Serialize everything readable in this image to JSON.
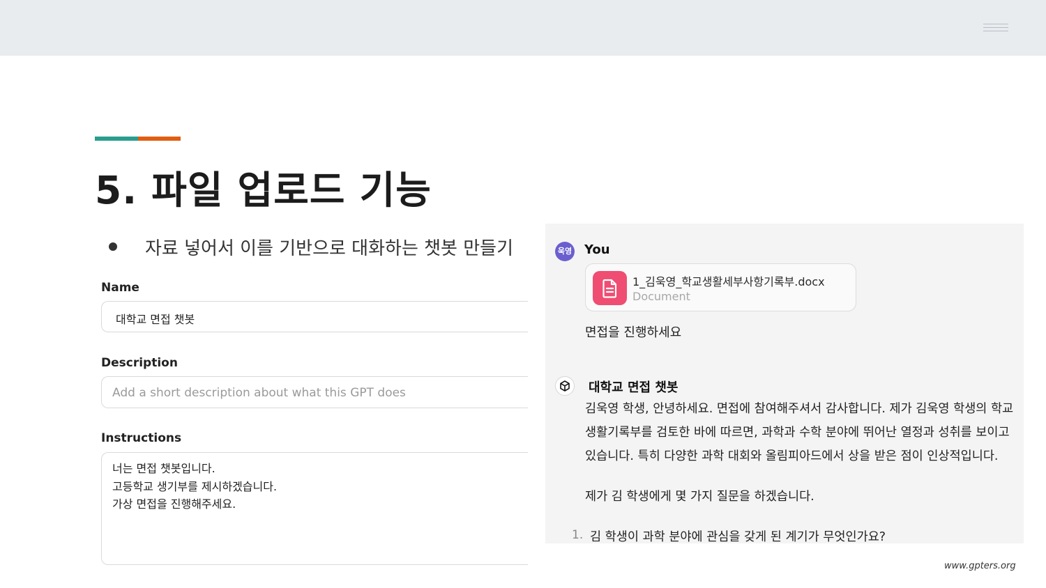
{
  "slide": {
    "title": "5. 파일 업로드 기능",
    "bullet": "자료 넣어서 이를 기반으로 대화하는 챗봇 만들기",
    "footer": "www.gpters.org",
    "accent_colors": [
      "#2a9d8f",
      "#e05d12"
    ]
  },
  "form": {
    "name_label": "Name",
    "name_value": "대학교 면접 챗봇",
    "description_label": "Description",
    "description_placeholder": "Add a short description about what this GPT does",
    "instructions_label": "Instructions",
    "instructions_lines": [
      "너는 면접 챗봇입니다.",
      "고등학교 생기부를 제시하겠습니다.",
      "가상 면접을 진행해주세요."
    ]
  },
  "chat": {
    "user": {
      "avatar_text": "욱영",
      "name": "You",
      "file_name": "1_김욱영_학교생활세부사항기록부.docx",
      "file_type": "Document",
      "file_icon": "document-icon",
      "message": "면접을 진행하세요"
    },
    "bot": {
      "avatar_icon": "gpt-cube-icon",
      "name": "대학교 면접 챗봇",
      "lines": [
        "김욱영 학생, 안녕하세요. 면접에 참여해주셔서 감사합니다. 제가 김욱영 학생의 학교",
        "생활기록부를 검토한 바에 따르면, 과학과 수학 분야에 뛰어난 열정과 성취를 보이고",
        "있습니다. 특히 다양한 과학 대회와 올림피아드에서 상을 받은 점이 인상적입니다.",
        "제가 김 학생에게 몇 가지 질문을 하겠습니다."
      ],
      "list_number": "1.",
      "list_item": "김 학생이 과학 분야에 관심을 갖게 된 계기가 무엇인가요?"
    }
  }
}
